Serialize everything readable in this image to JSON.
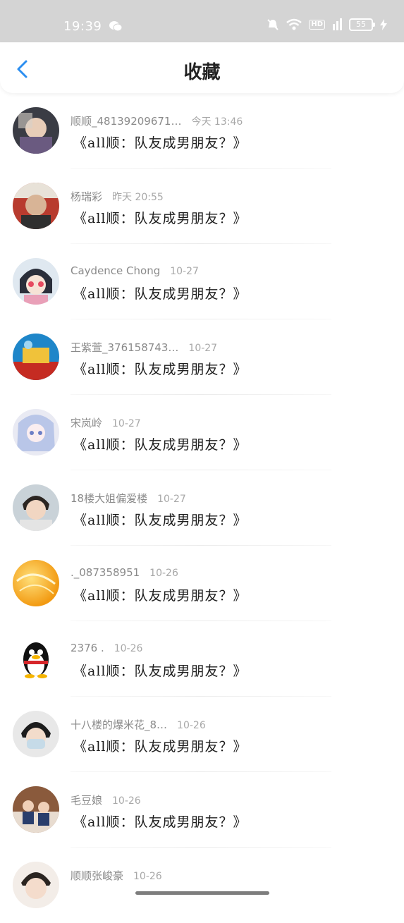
{
  "status_bar": {
    "time": "19:39",
    "battery": "55",
    "hd": "HD"
  },
  "header": {
    "title": "收藏",
    "back_icon": "chevron-left-icon",
    "accent_color": "#2c8ef0"
  },
  "items": [
    {
      "name": "顺顺_48139209671…",
      "time": "今天 13:46",
      "message": "《all顺：队友成男朋友？》"
    },
    {
      "name": "杨瑞彩",
      "time": "昨天 20:55",
      "message": "《all顺：队友成男朋友？》"
    },
    {
      "name": "Caydence Chong",
      "time": "10-27",
      "message": "《all顺：队友成男朋友？》"
    },
    {
      "name": "王紫萱_376158743…",
      "time": "10-27",
      "message": "《all顺：队友成男朋友？》"
    },
    {
      "name": "宋岚岭",
      "time": "10-27",
      "message": "《all顺：队友成男朋友？》"
    },
    {
      "name": "18楼大姐偏爱楼",
      "time": "10-27",
      "message": "《all顺：队友成男朋友？》"
    },
    {
      "name": "._087358951",
      "time": "10-26",
      "message": "《all顺：队友成男朋友？》"
    },
    {
      "name": "2376 .",
      "time": "10-26",
      "message": "《all顺：队友成男朋友？》"
    },
    {
      "name": "十八楼的爆米花_8…",
      "time": "10-26",
      "message": "《all顺：队友成男朋友？》"
    },
    {
      "name": "毛豆娘",
      "time": "10-26",
      "message": "《all顺：队友成男朋友？》"
    },
    {
      "name": "顺顺张峻豪",
      "time": "10-26",
      "message": ""
    }
  ]
}
